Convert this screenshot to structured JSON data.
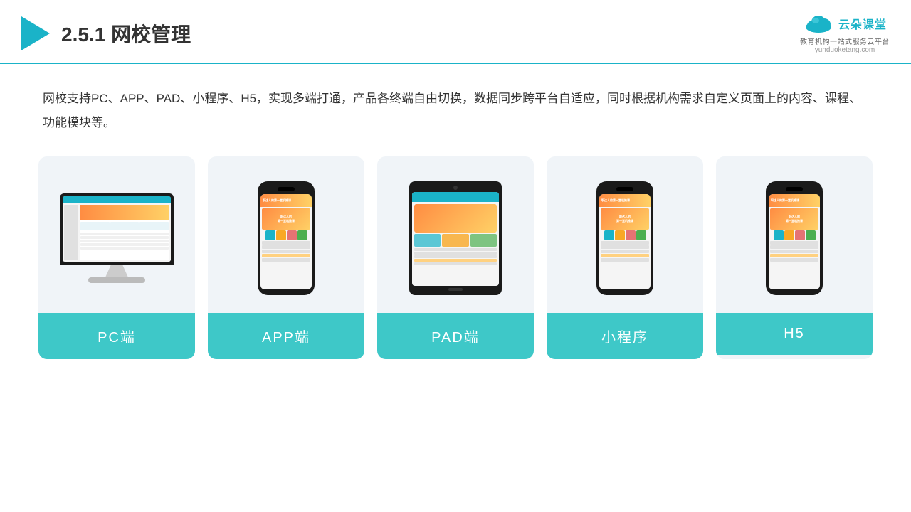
{
  "header": {
    "title": "2.5.1网校管理",
    "title_num": "2.5.1",
    "title_text": "网校管理"
  },
  "logo": {
    "name": "云朵课堂",
    "domain": "yunduoketang.com",
    "tagline": "教育机构一站",
    "tagline2": "式服务云平台"
  },
  "description": {
    "text": "网校支持PC、APP、PAD、小程序、H5，实现多端打通，产品各终端自由切换，数据同步跨平台自适应，同时根据机构需求自定义页面上的内容、课程、功能模块等。"
  },
  "cards": [
    {
      "id": "pc",
      "label": "PC端"
    },
    {
      "id": "app",
      "label": "APP端"
    },
    {
      "id": "pad",
      "label": "PAD端"
    },
    {
      "id": "miniprogram",
      "label": "小程序"
    },
    {
      "id": "h5",
      "label": "H5"
    }
  ]
}
